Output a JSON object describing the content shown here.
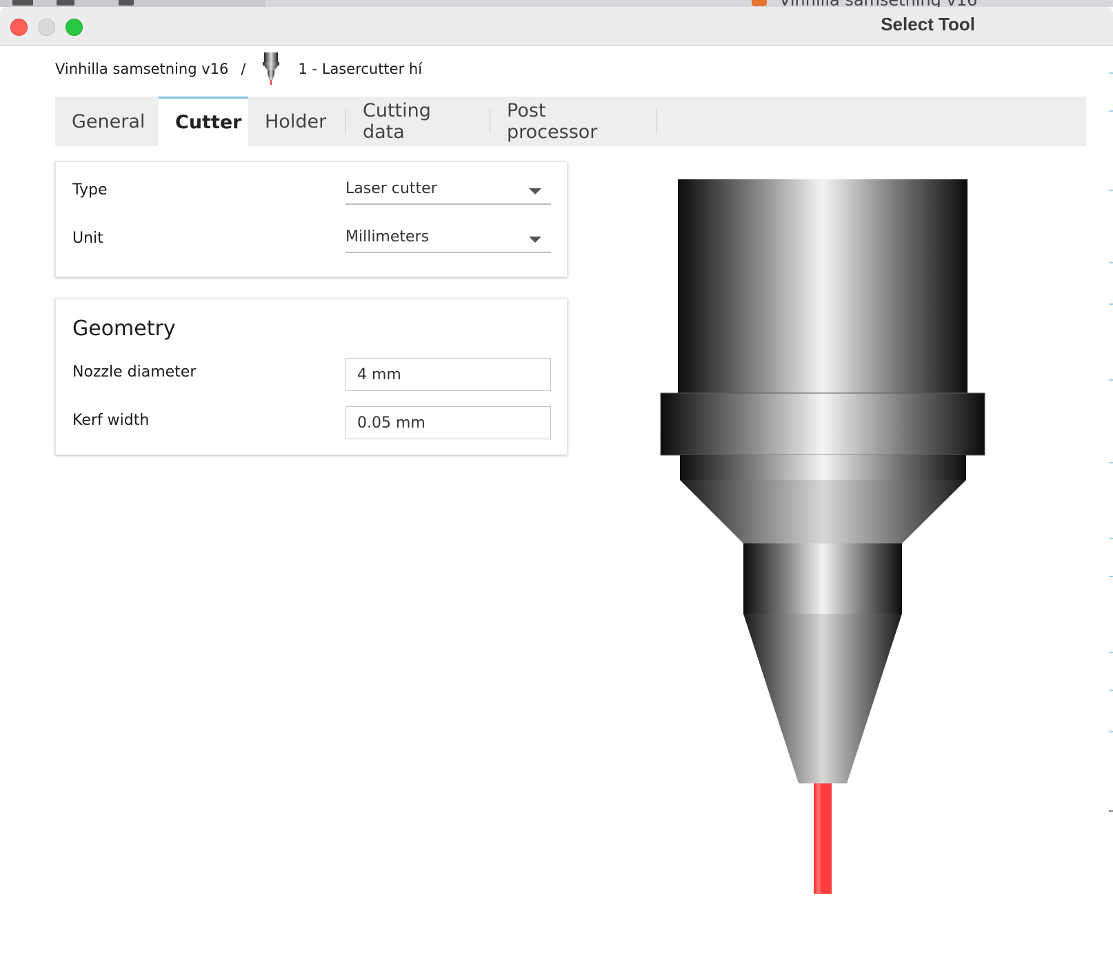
{
  "background_window": {
    "title": "Vinhilla samsetning v16"
  },
  "window": {
    "title": "Select Tool"
  },
  "breadcrumb": {
    "project": "Vinhilla samsetning v16",
    "separator": "/",
    "tool": "1 - Lasercutter hí"
  },
  "tabs": [
    {
      "label": "General",
      "active": false
    },
    {
      "label": "Cutter",
      "active": true
    },
    {
      "label": "Holder",
      "active": false
    },
    {
      "label": "Cutting data",
      "active": false
    },
    {
      "label": "Post processor",
      "active": false
    }
  ],
  "settings": {
    "type_label": "Type",
    "type_value": "Laser cutter",
    "unit_label": "Unit",
    "unit_value": "Millimeters"
  },
  "geometry": {
    "title": "Geometry",
    "nozzle_label": "Nozzle diameter",
    "nozzle_value": "4 mm",
    "kerf_label": "Kerf width",
    "kerf_value": "0.05 mm"
  },
  "colors": {
    "active_tab_accent": "#7fbfe3",
    "laser_beam": "#ff3b3b",
    "close": "#fe5f57",
    "maximize": "#28c840"
  },
  "icons": {
    "tool": "laser-nozzle-icon",
    "dropdown": "chevron-down-icon"
  }
}
